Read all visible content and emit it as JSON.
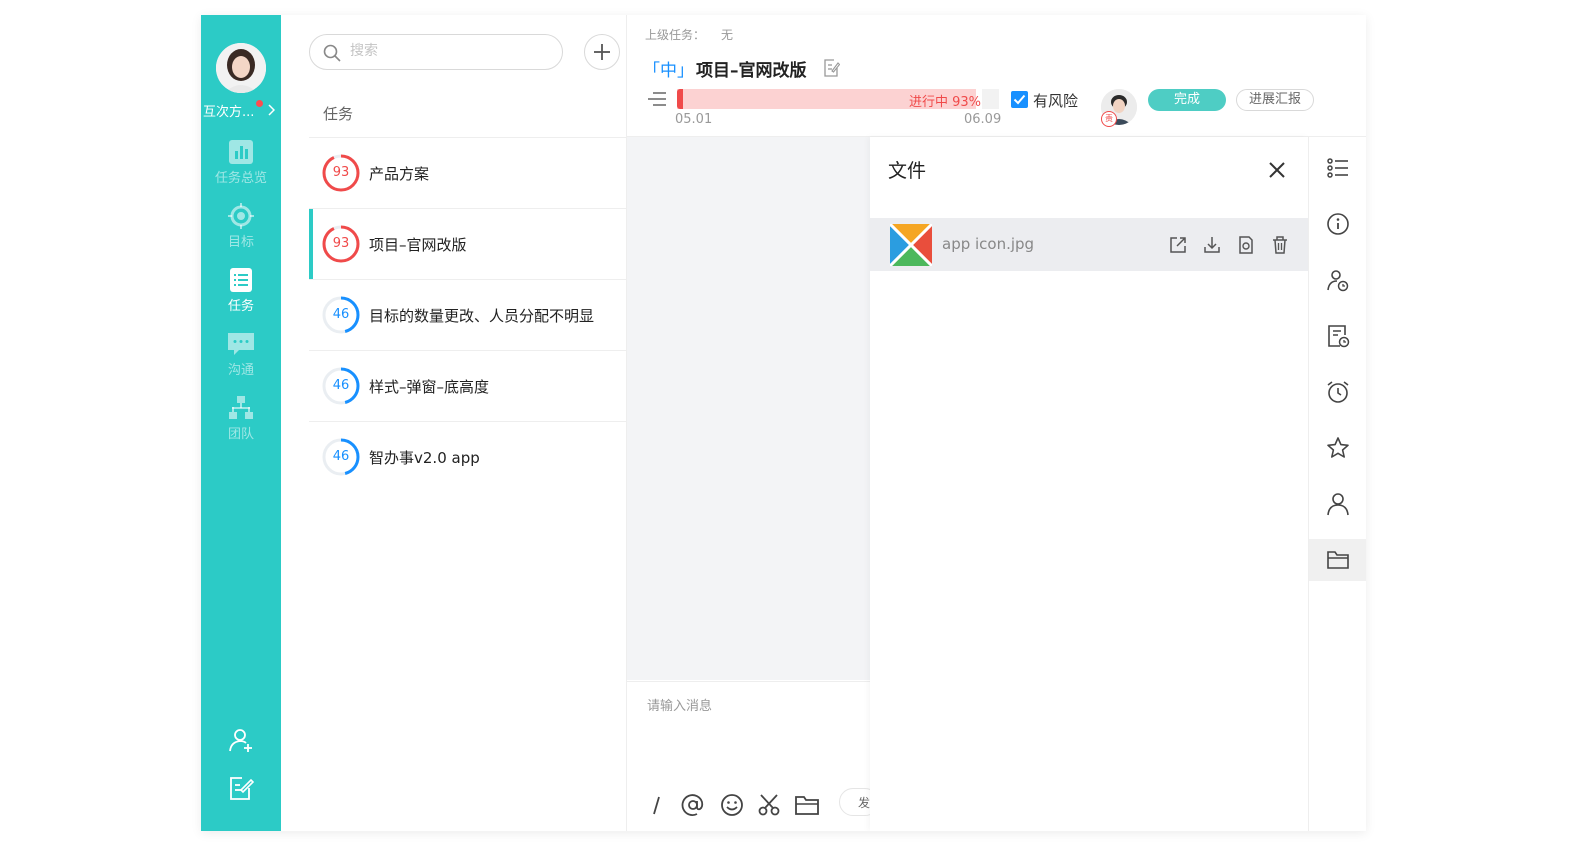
{
  "user": {
    "name": "互次方..."
  },
  "nav": [
    {
      "label": "任务总览"
    },
    {
      "label": "目标"
    },
    {
      "label": "任务"
    },
    {
      "label": "沟通"
    },
    {
      "label": "团队"
    }
  ],
  "search": {
    "placeholder": "搜索"
  },
  "list": {
    "section_title": "任务",
    "tasks": [
      {
        "progress": 93,
        "name": "产品方案",
        "color": "#f04a4a"
      },
      {
        "progress": 93,
        "name": "项目–官网改版",
        "color": "#f04a4a"
      },
      {
        "progress": 46,
        "name": "目标的数量更改、人员分配不明显",
        "color": "#1890ff"
      },
      {
        "progress": 46,
        "name": "样式–弹窗–底高度",
        "color": "#1890ff"
      },
      {
        "progress": 46,
        "name": "智办事v2.0 app",
        "color": "#1890ff"
      }
    ]
  },
  "detail": {
    "parent_label": "上级任务：",
    "parent_value": "无",
    "priority": "「中」",
    "title": "项目–官网改版",
    "progress_text": "进行中 93%",
    "progress_value": 93,
    "date_start": "05.01",
    "date_end": "06.09",
    "risk_label": "有风险",
    "owner_badge": "责",
    "done_label": "完成",
    "report_label": "进展汇报"
  },
  "chat": {
    "placeholder": "请输入消息",
    "send_label": "发"
  },
  "files": {
    "title": "文件",
    "items": [
      {
        "name": "app icon.jpg"
      }
    ]
  },
  "colors": {
    "brand": "#2ccbc6",
    "danger": "#f04a4a",
    "primary": "#1890ff"
  }
}
